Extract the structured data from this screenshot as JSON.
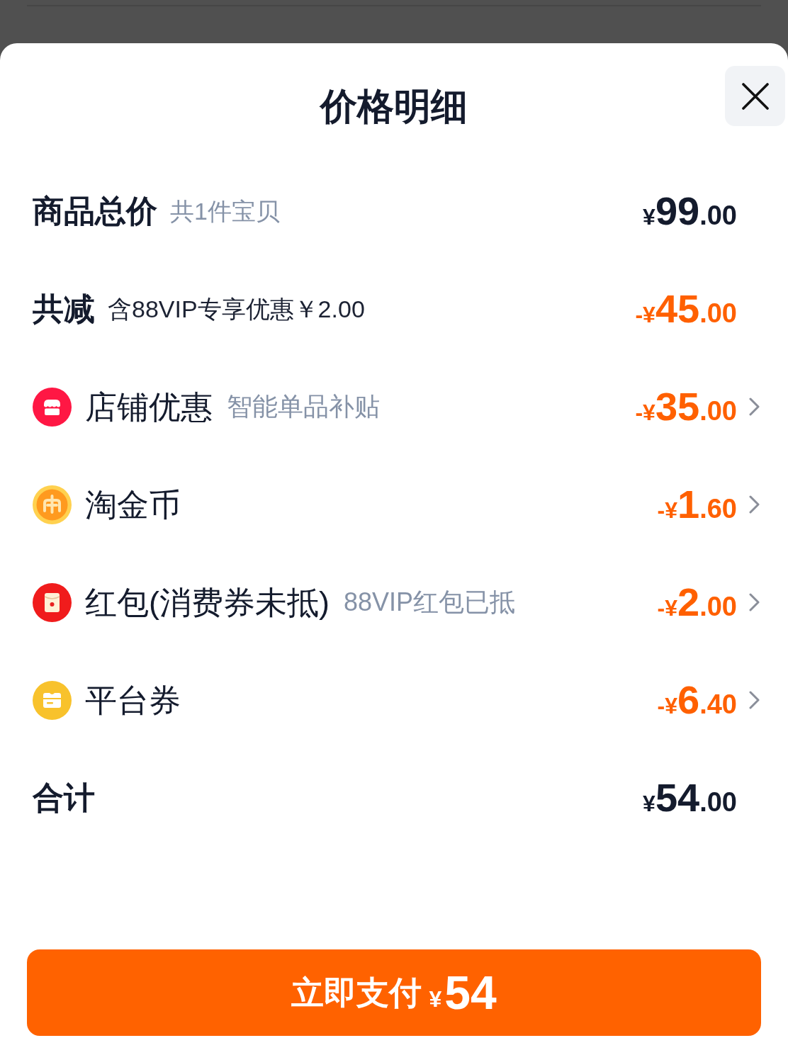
{
  "sheet": {
    "title": "价格明细"
  },
  "rows": [
    {
      "kind": "summary",
      "label": "商品总价",
      "note": "共1件宝贝",
      "note_muted": true,
      "amount": {
        "prefix": "¥",
        "integer": "99",
        "fraction": ".00"
      },
      "deduction": false,
      "chevron": false
    },
    {
      "kind": "summary",
      "label": "共减",
      "note": "含88VIP专享优惠￥2.00",
      "note_muted": false,
      "amount": {
        "prefix": "-¥",
        "integer": "45",
        "fraction": ".00"
      },
      "deduction": true,
      "chevron": false
    },
    {
      "kind": "store",
      "label": "店铺优惠",
      "note": "智能单品补贴",
      "note_muted": true,
      "amount": {
        "prefix": "-¥",
        "integer": "35",
        "fraction": ".00"
      },
      "deduction": true,
      "chevron": true
    },
    {
      "kind": "coin",
      "label": "淘金币",
      "amount": {
        "prefix": "-¥",
        "integer": "1",
        "fraction": ".60"
      },
      "deduction": true,
      "chevron": true
    },
    {
      "kind": "packet",
      "label": "红包(消费券未抵)",
      "note": "88VIP红包已抵",
      "note_muted": true,
      "amount": {
        "prefix": "-¥",
        "integer": "2",
        "fraction": ".00"
      },
      "deduction": true,
      "chevron": true
    },
    {
      "kind": "coupon",
      "label": "平台券",
      "amount": {
        "prefix": "-¥",
        "integer": "6",
        "fraction": ".40"
      },
      "deduction": true,
      "chevron": true
    },
    {
      "kind": "summary",
      "label": "合计",
      "amount": {
        "prefix": "¥",
        "integer": "54",
        "fraction": ".00"
      },
      "deduction": false,
      "chevron": false
    }
  ],
  "pay_button": {
    "label": "立即支付",
    "currency": "¥",
    "amount": "54"
  }
}
